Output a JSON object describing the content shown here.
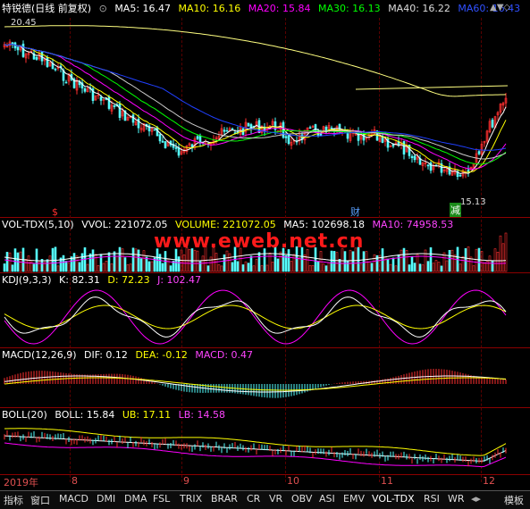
{
  "main_header": {
    "title": "特锐德(日线 前复权)",
    "ma5": "MA5: 16.47",
    "ma10": "MA10: 16.16",
    "ma20": "MA20: 15.84",
    "ma30": "MA30: 16.13",
    "ma40": "MA40: 16.22",
    "ma60": "MA60: 16.43",
    "high_label": "20.45",
    "low_label": "15.13",
    "marker_dollar": "$",
    "marker_cai": "财",
    "marker_jian": "减"
  },
  "watermark": "www.eweb.net.cn",
  "vol_header": {
    "name": "VOL-TDX(5,10)",
    "vvol": "VVOL: 221072.05",
    "volume": "VOLUME: 221072.05",
    "ma5": "MA5: 102698.18",
    "ma10": "MA10: 74958.53"
  },
  "kdj_header": {
    "name": "KDJ(9,3,3)",
    "k": "K: 82.31",
    "d": "D: 72.23",
    "j": "J: 102.47"
  },
  "macd_header": {
    "name": "MACD(12,26,9)",
    "dif": "DIF: 0.12",
    "dea": "DEA: -0.12",
    "macd": "MACD: 0.47"
  },
  "boll_header": {
    "name": "BOLL(20)",
    "boll": "BOLL: 15.84",
    "ub": "UB: 17.11",
    "lb": "LB: 14.58"
  },
  "dates": [
    "2019年",
    "8",
    "9",
    "10",
    "11",
    "12"
  ],
  "toolbar": [
    "指标",
    "窗口",
    "MACD",
    "DMI",
    "DMA",
    "FSL",
    "TRIX",
    "BRAR",
    "CR",
    "VR",
    "OBV",
    "ASI",
    "EMV",
    "VOL-TDX",
    "RSI",
    "WR",
    "模板"
  ],
  "colors": {
    "up": "#ff3030",
    "down": "#54ffff",
    "ma5": "#ffffff",
    "ma10": "#ffff00",
    "ma20": "#ff00ff",
    "ma30": "#00ff00",
    "ma40": "#cccccc",
    "ma60": "#2040ff",
    "long": "#ffff80"
  }
}
